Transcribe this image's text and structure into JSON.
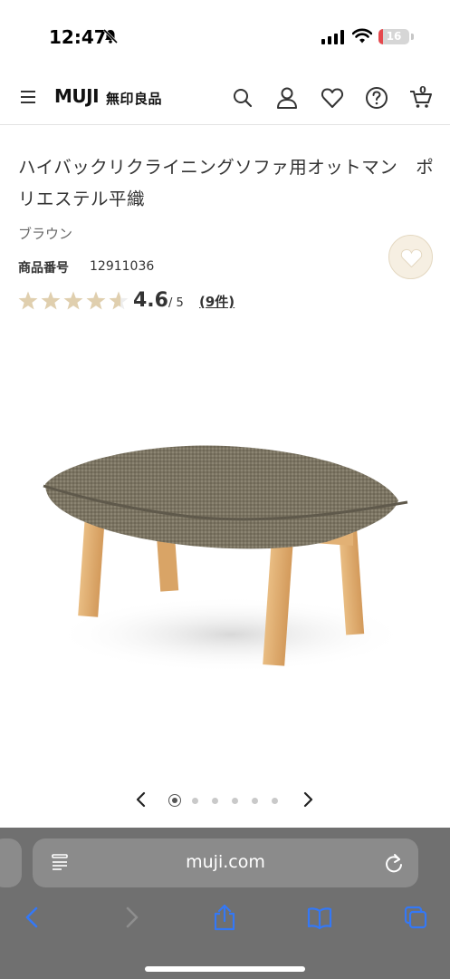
{
  "status_bar": {
    "time": "12:47",
    "battery_level": "16",
    "battery_fraction": 0.16,
    "battery_color": "#e5484d",
    "icons": [
      "bell-slash-icon",
      "signal-icon",
      "wifi-icon",
      "battery-icon"
    ]
  },
  "header": {
    "logo": "MUJI",
    "logo_jp": "無印良品",
    "icons": [
      "menu-icon",
      "search-icon",
      "account-icon",
      "favorites-icon",
      "help-icon",
      "cart-icon"
    ],
    "cart_count": "0"
  },
  "product": {
    "title": "ハイバックリクライニングソファ用オットマン　ポリエステル平織",
    "color": "ブラウン",
    "item_number_label": "商品番号",
    "item_number": "12911036",
    "rating": "4.6",
    "rating_max": "/ 5",
    "rating_stars": 4.6,
    "review_count": "(9件)",
    "star_color": "#e0cfae"
  },
  "carousel": {
    "slide_count": 6,
    "active_index": 0
  },
  "browser": {
    "url": "muji.com",
    "accent_color": "#3478f6",
    "icons": [
      "reader-icon",
      "reload-icon",
      "back-icon",
      "forward-icon",
      "share-icon",
      "bookmarks-icon",
      "tabs-icon"
    ]
  }
}
